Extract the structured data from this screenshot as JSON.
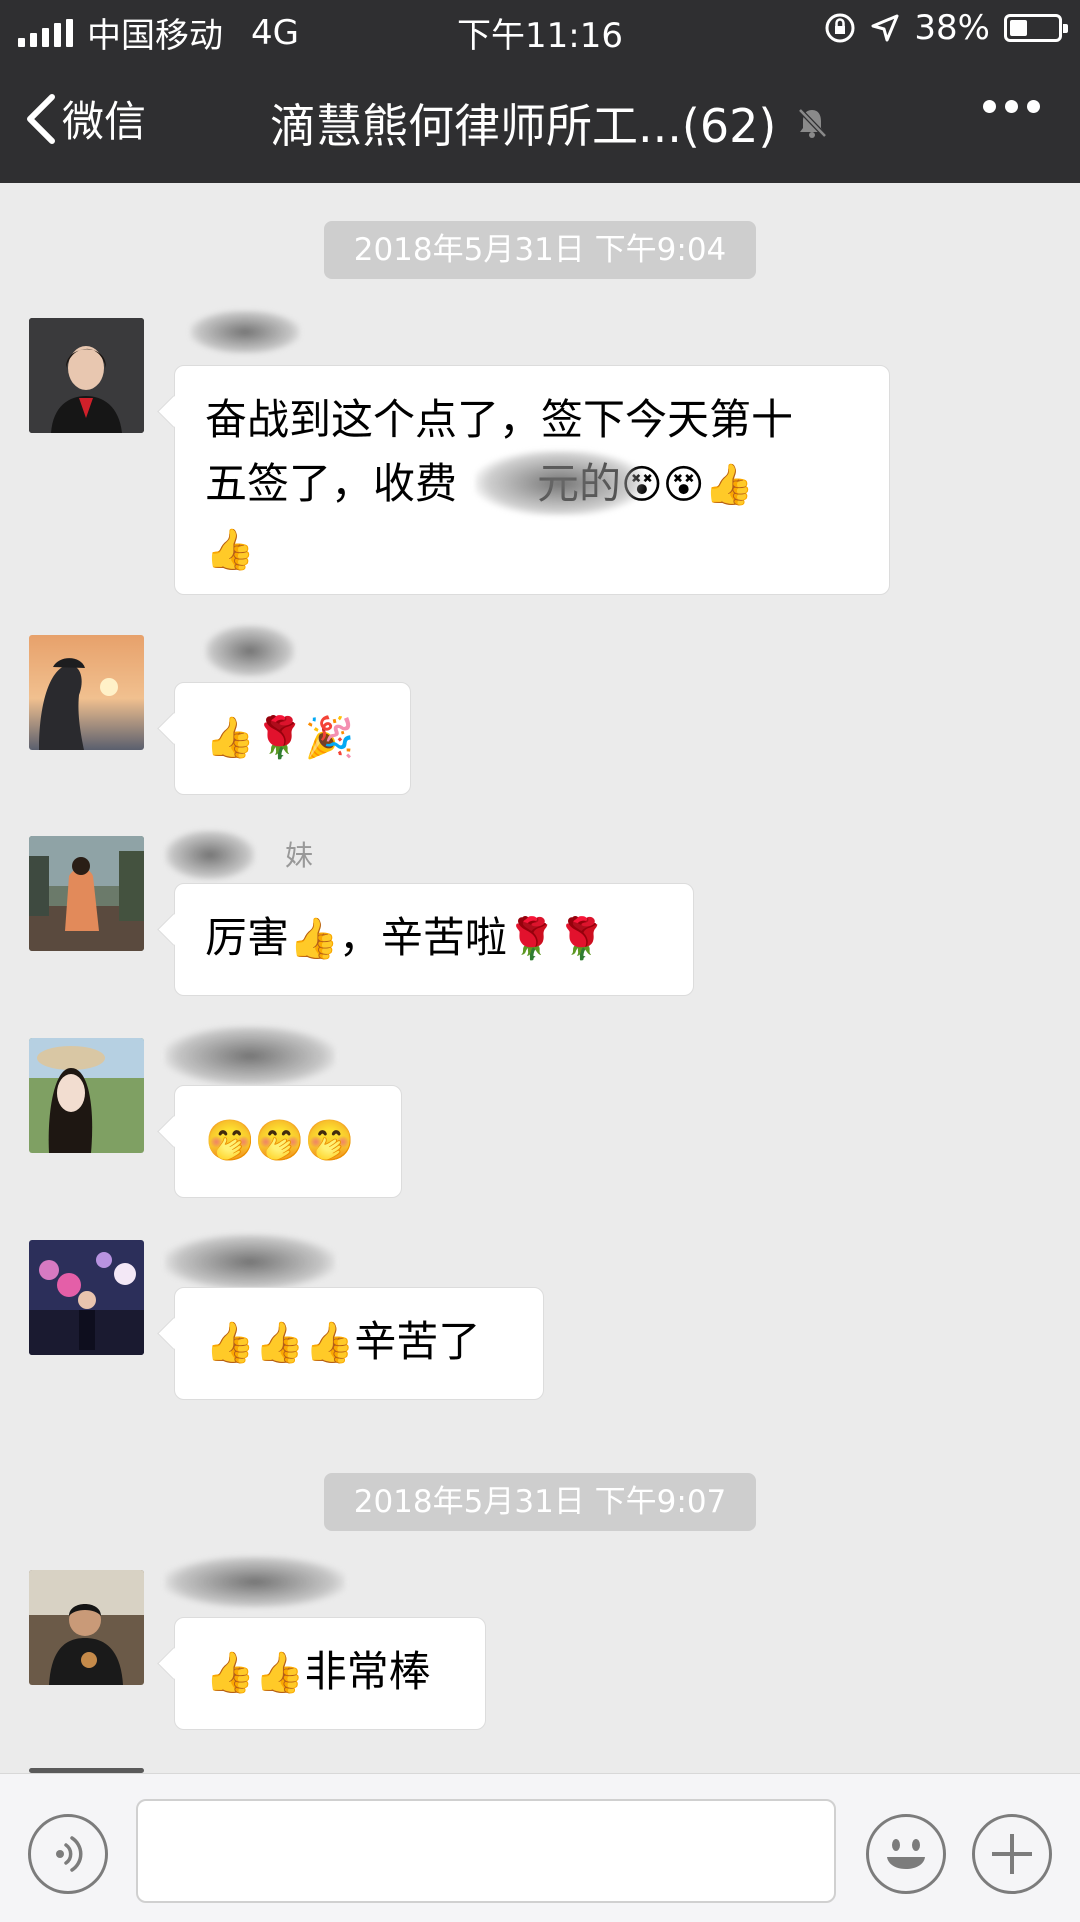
{
  "status_bar": {
    "carrier": "中国移动",
    "network": "4G",
    "time": "下午11:16",
    "battery": "38%",
    "battery_level": 0.38
  },
  "nav": {
    "back_label": "微信",
    "title": "滴慧熊何律师所工...(62)"
  },
  "chat": {
    "timestamp_1": "2018年5月31日 下午9:04",
    "timestamp_2": "2018年5月31日 下午9:07",
    "messages": [
      {
        "nickname": "",
        "text_line1": "奋战到这个点了，签下今天第十",
        "text_line2a": "五签了，收费",
        "text_line2b": "元的",
        "emoji_1": "😵😵👍",
        "emoji_2": "👍"
      },
      {
        "nickname": "",
        "emoji": "👍🌹🎉"
      },
      {
        "nickname": "妹",
        "text_a": "厉害",
        "emoji_a": "👍",
        "text_b": "，辛苦啦",
        "emoji_b": "🌹🌹"
      },
      {
        "nickname": "",
        "emoji": "🤭🤭🤭"
      },
      {
        "nickname": "",
        "emoji": "👍👍👍",
        "text": "辛苦了"
      },
      {
        "nickname": "",
        "emoji": "👍👍",
        "text": "非常棒"
      }
    ]
  },
  "colors": {
    "header_bg": "#2f2f31",
    "chat_bg": "#ebebeb",
    "bubble_bg": "#ffffff",
    "timestamp_bg": "#cecece"
  },
  "icons": [
    "signal-icon",
    "location-arrow-icon",
    "rotation-lock-icon",
    "battery-icon",
    "back-chevron-icon",
    "mute-bell-icon",
    "more-icon",
    "voice-icon",
    "emoji-icon",
    "add-icon"
  ]
}
